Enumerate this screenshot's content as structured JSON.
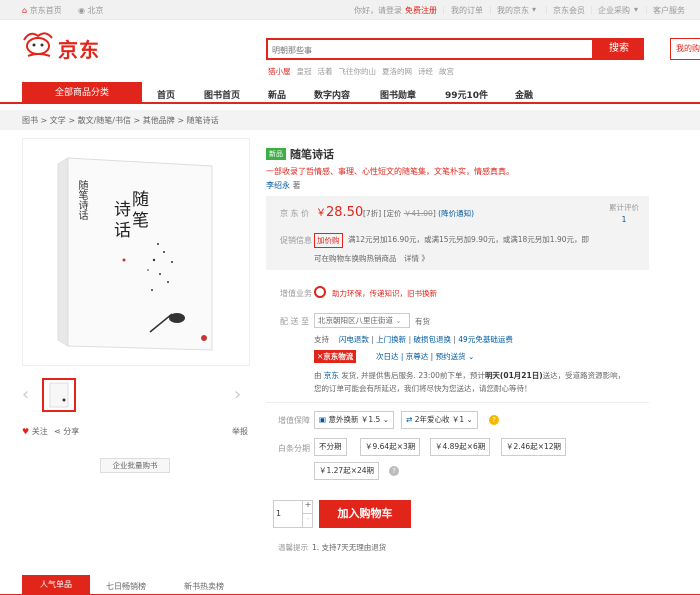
{
  "topbar": {
    "home": "京东首页",
    "location": "北京",
    "greeting": "你好，请登录",
    "register": "免费注册",
    "orders": "我的订单",
    "myjd": "我的京东",
    "vip": "京东会员",
    "enterprise": "企业采购",
    "service": "客户服务"
  },
  "header": {
    "logo": "京东",
    "search_placeholder": "明朝那些事",
    "search_button": "搜索",
    "cart": "我的购物车",
    "hotwords": [
      "猎小屋",
      "皇冠",
      "活着",
      "飞往你的山",
      "夏洛的网",
      "诗经",
      "故宫"
    ]
  },
  "nav": {
    "all_categories": "全部商品分类",
    "items": [
      "首页",
      "图书首页",
      "新品",
      "数字内容",
      "图书勋章",
      "99元10件",
      "金融"
    ]
  },
  "breadcrumb": [
    "图书",
    "文学",
    "散文/随笔/书信",
    "其他品牌",
    "随笔诗话"
  ],
  "gallery": {
    "book_title_line1": "随笔",
    "book_title_line2": "诗话",
    "follow": "关注",
    "share": "分享",
    "report": "举报",
    "bulk_buy": "企业批量购书"
  },
  "product": {
    "badge": "新品",
    "title": "随笔诗话",
    "subtitle": "一部收录了哲情感、事理、心性短文的随笔集，文笔朴实，情感真真。",
    "author_name": "李绍永",
    "author_suffix": "著",
    "price_label": "京 东 价",
    "currency": "￥",
    "price": "28.50",
    "discount": "[7折]",
    "list_price_label": "[定价",
    "list_price": "￥41.00",
    "list_price_close": "]",
    "notify": "(降价通知)",
    "review_label": "累计评价",
    "review_count": "1",
    "promo_label": "促销信息",
    "promo_tag": "加价购",
    "promo_text": "满12元另加16.90元，或满15元另加9.90元，或满18元另加1.90元，即",
    "promo_text2": "可在购物车换购热销商品　详情 》"
  },
  "services": {
    "label": "增值业务",
    "text": "助力环保，传递知识，旧书换新"
  },
  "delivery": {
    "label": "配 送 至",
    "address": "北京朝阳区八里庄街道",
    "stock": "有货",
    "support_label": "支持",
    "support_items": [
      "闪电退款",
      "上门换新",
      "破损包退换",
      "49元免基础运费"
    ],
    "logistics": "京东物流",
    "logistics_options": [
      "次日达",
      "京尊达",
      "预约送货"
    ],
    "ship_line1_a": "由",
    "ship_line1_jd": "京东",
    "ship_line1_b": "发货, 并提供售后服务. 23:00前下单，预计",
    "ship_line1_date": "明天(01月21日)",
    "ship_line1_c": "送达，受道路资源影响，",
    "ship_line2": "您的订单可能会有所延迟，我们将尽快为您送达，请您耐心等待！"
  },
  "protection": {
    "label": "增值保障",
    "opt1": "意外换新 ￥1.5",
    "opt2": "2年爱心收 ￥1"
  },
  "installments": {
    "label": "白条分期",
    "options": [
      "不分期",
      "￥9.64起×3期",
      "￥4.89起×6期",
      "￥2.46起×12期",
      "￥1.27起×24期"
    ]
  },
  "cart": {
    "quantity": "1",
    "plus": "+",
    "minus": "-",
    "add_button": "加入购物车"
  },
  "tip": {
    "label": "温馨提示",
    "text": "1.  支持7天无理由退货"
  },
  "tabs": [
    "人气单品",
    "七日畅销榜",
    "新书热卖榜"
  ]
}
